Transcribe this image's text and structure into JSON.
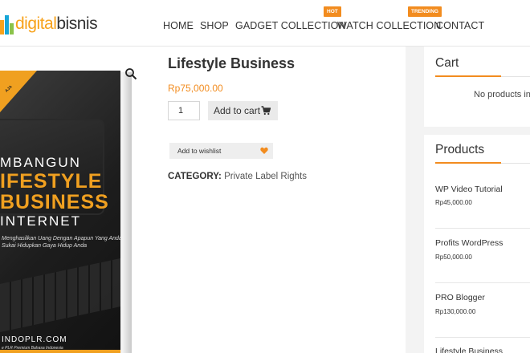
{
  "logo": {
    "part1": "digital",
    "part2": "bisnis"
  },
  "nav": {
    "items": [
      "HOME",
      "SHOP",
      "GADGET COLLECTION",
      "WATCH COLLECTION",
      "CONTACT"
    ],
    "badges": {
      "gadget": "HOT",
      "watch": "TRENDING"
    }
  },
  "book": {
    "corner": "AJA",
    "line1": "MBANGUN",
    "line2": "IFESTYLE",
    "line3": "BUSINESS",
    "line4": "INTERNET",
    "subtitle": "Menghasilkan Uang Dengan Apapun Yang Anda Sukai Hidupkan Gaya Hidup Anda",
    "url": "INDOPLR.COM",
    "tagline": "e PLR Premium Bahasa Indonesia"
  },
  "product": {
    "title": "Lifestyle Business",
    "price": "Rp75,000.00",
    "quantity": "1",
    "add_to_cart": "Add to cart",
    "wishlist": "Add to wishlist",
    "category_label": "CATEGORY:",
    "category_value": "Private Label Rights"
  },
  "sidebar": {
    "cart_title": "Cart",
    "cart_empty": "No products in",
    "products_title": "Products",
    "products": [
      {
        "name": "WP Video Tutorial",
        "price": "Rp45,000.00"
      },
      {
        "name": "Profits WordPress",
        "price": "Rp50,000.00"
      },
      {
        "name": "PRO Blogger",
        "price": "Rp130,000.00"
      },
      {
        "name": "Lifestyle Business",
        "price": ""
      }
    ]
  },
  "colors": {
    "accent": "#f28c1f",
    "logo_orange": "#f7a21b",
    "logo_blue": "#17a6d8"
  }
}
